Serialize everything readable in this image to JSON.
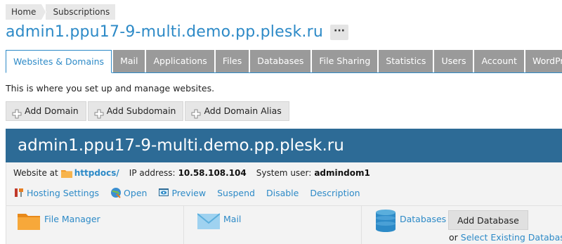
{
  "breadcrumb": {
    "items": [
      "Home",
      "Subscriptions"
    ]
  },
  "page": {
    "title": "admin1.ppu17-9-multi.demo.pp.plesk.ru",
    "more_label": "···"
  },
  "tabs": [
    {
      "label": "Websites & Domains",
      "active": true
    },
    {
      "label": "Mail"
    },
    {
      "label": "Applications"
    },
    {
      "label": "Files"
    },
    {
      "label": "Databases"
    },
    {
      "label": "File Sharing"
    },
    {
      "label": "Statistics"
    },
    {
      "label": "Users"
    },
    {
      "label": "Account"
    },
    {
      "label": "WordPress"
    }
  ],
  "intro": "This is where you set up and manage websites.",
  "toolbar": {
    "add_domain": "Add Domain",
    "add_subdomain": "Add Subdomain",
    "add_domain_alias": "Add Domain Alias"
  },
  "domain": {
    "name": "admin1.ppu17-9-multi.demo.pp.plesk.ru",
    "website_at_label": "Website at",
    "docroot": "httpdocs/",
    "ip_label": "IP address:",
    "ip": "10.58.108.104",
    "sysuser_label": "System user:",
    "sysuser": "admindom1",
    "actions": {
      "hosting_settings": "Hosting Settings",
      "open": "Open",
      "preview": "Preview",
      "suspend": "Suspend",
      "disable": "Disable",
      "description": "Description"
    },
    "cards": {
      "file_manager": "File Manager",
      "mail": "Mail",
      "databases": "Databases",
      "add_database": "Add Database",
      "or_label": "or",
      "select_existing_database": "Select Existing Database"
    }
  },
  "colors": {
    "accent": "#2d8ac7",
    "header_bg": "#2d6b96",
    "tab_inactive": "#9a9a9a",
    "folder": "#f39c2a"
  },
  "icons": [
    "plus-icon",
    "folder-icon",
    "wrench-icon",
    "globe-icon",
    "preview-icon",
    "mail-envelope-icon",
    "database-icon"
  ]
}
